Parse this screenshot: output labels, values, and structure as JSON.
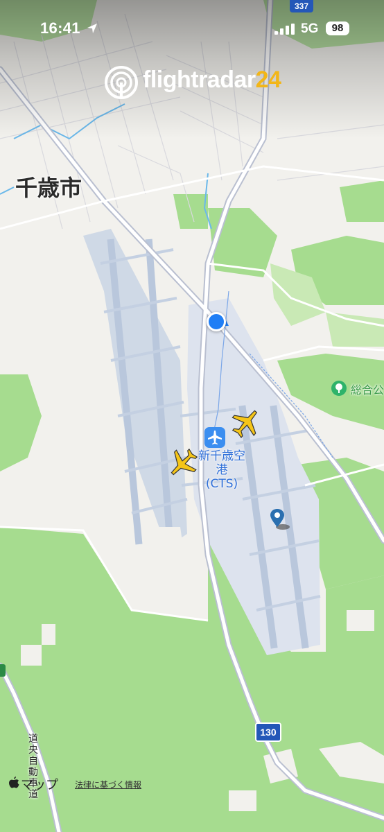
{
  "status_bar": {
    "time": "16:41",
    "network": "5G",
    "battery": "98"
  },
  "header": {
    "logo_text": "flightradar",
    "logo_number": "24"
  },
  "map": {
    "city_label": "千歳市",
    "airport": {
      "name_line1": "新千歳空港",
      "name_line2": "(CTS)"
    },
    "park_label": "総合公",
    "route_badges": [
      "130",
      "337"
    ],
    "highway_label": "道央自動車道",
    "aircraft": [
      {
        "id": "aircraft-1",
        "color": "#f5c518"
      },
      {
        "id": "aircraft-2",
        "color": "#f5c518"
      }
    ],
    "colors": {
      "land": "#f2f1ed",
      "park": "#a6dc8f",
      "airport_area": "#dde3ee",
      "runway": "#c8d3e2",
      "road": "#ffffff",
      "road_casing": "#b9bfd0",
      "user_location": "#1f7ef5",
      "airport_icon": "#3b8ef0"
    }
  },
  "attribution": {
    "maps_label": "マップ",
    "legal_link": "法律に基づく情報"
  }
}
